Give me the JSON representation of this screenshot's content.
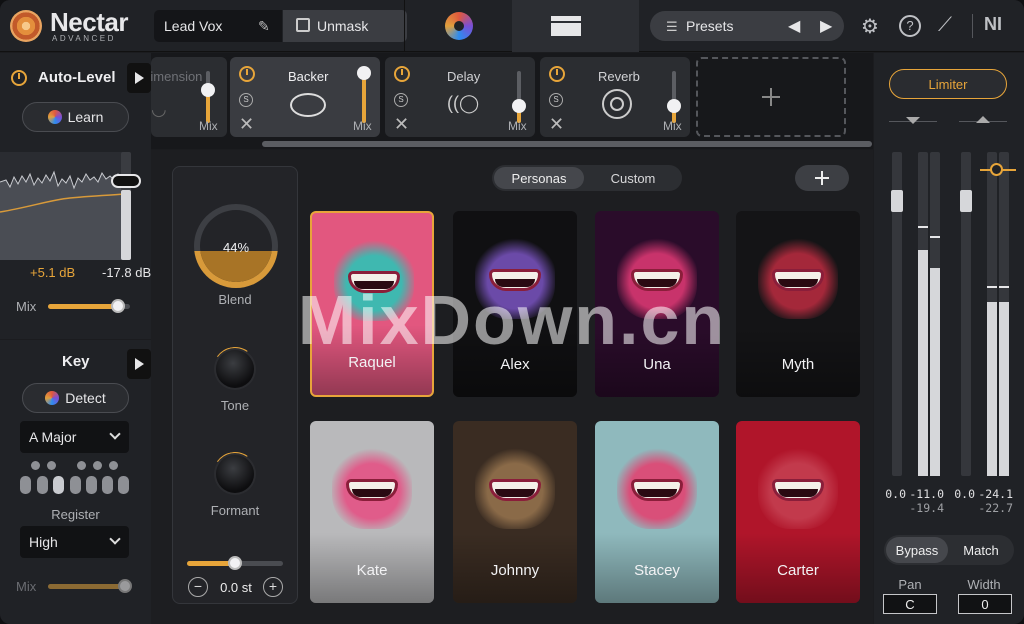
{
  "header": {
    "app_name": "Nectar",
    "app_edition": "ADVANCED",
    "track_name": "Lead Vox",
    "unmask_label": "Unmask",
    "presets_label": "Presets"
  },
  "auto_level": {
    "title": "Auto-Level",
    "learn_label": "Learn",
    "gain_value": "+5.1 dB",
    "target_value": "-17.8 dB",
    "mix_label": "Mix",
    "mix_level": 0.85
  },
  "key": {
    "title": "Key",
    "detect_label": "Detect",
    "key_value": "A Major",
    "register_label": "Register",
    "register_value": "High",
    "mix_label": "Mix"
  },
  "modules": [
    {
      "name": "Dimension",
      "mix_label": "Mix",
      "mix_level": 0.4
    },
    {
      "name": "Backer",
      "mix_label": "Mix",
      "mix_level": 0.85,
      "active": true
    },
    {
      "name": "Delay",
      "mix_label": "Mix",
      "mix_level": 0.25
    },
    {
      "name": "Reverb",
      "mix_label": "Mix",
      "mix_level": 0.25
    }
  ],
  "backer": {
    "blend_value": "44%",
    "blend_level": 0.44,
    "blend_label": "Blend",
    "tone_label": "Tone",
    "formant_label": "Formant",
    "pitch_value": "0.0 st",
    "tabs": [
      "Personas",
      "Custom"
    ],
    "personas": [
      {
        "name": "Raquel",
        "selected": true,
        "color": "#e2577f"
      },
      {
        "name": "Alex",
        "selected": false,
        "color": "#101012"
      },
      {
        "name": "Una",
        "selected": false,
        "color": "#2a0c2a"
      },
      {
        "name": "Myth",
        "selected": false,
        "color": "#141416"
      },
      {
        "name": "Kate",
        "selected": false,
        "color": "#b9b9bb"
      },
      {
        "name": "Johnny",
        "selected": false,
        "color": "#3a2c22"
      },
      {
        "name": "Stacey",
        "selected": false,
        "color": "#8fb9bd"
      },
      {
        "name": "Carter",
        "selected": false,
        "color": "#b0152a"
      }
    ]
  },
  "output": {
    "limiter_label": "Limiter",
    "meters_left": {
      "peak_a": "0.0",
      "peak_b": "-11.0",
      "rms": "-19.4"
    },
    "meters_right": {
      "peak_a": "0.0",
      "peak_b": "-24.1",
      "rms": "-22.7"
    },
    "bypass_label": "Bypass",
    "match_label": "Match",
    "pan_label": "Pan",
    "pan_value": "C",
    "width_label": "Width",
    "width_value": "0"
  },
  "watermark": "MixDown.cn",
  "colors": {
    "accent": "#e7a53a",
    "background": "#1b1c1f"
  }
}
